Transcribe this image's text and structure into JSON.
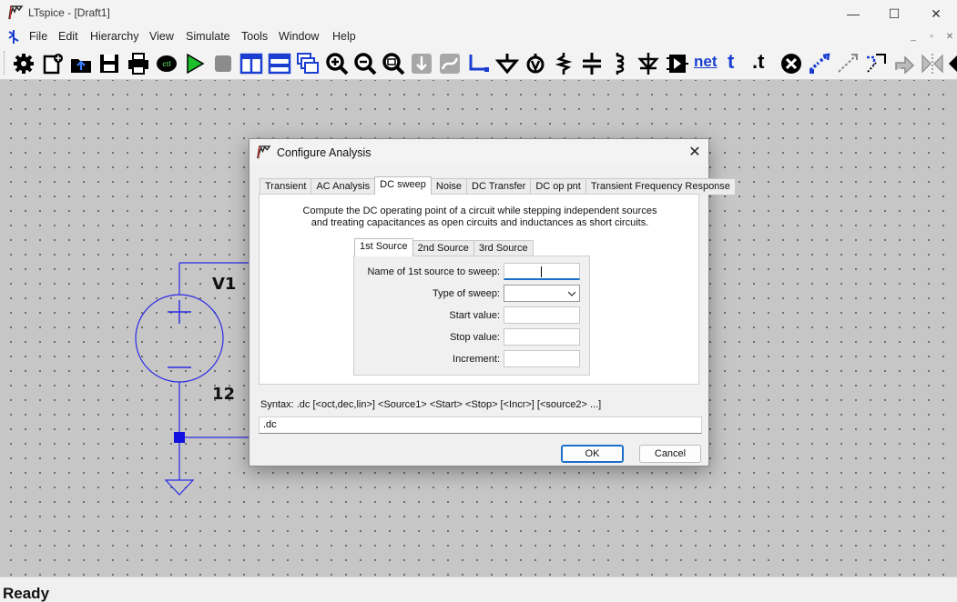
{
  "window": {
    "title": "LTspice - [Draft1]",
    "controls": {
      "minimize": "—",
      "maximize": "☐",
      "close": "✕"
    }
  },
  "menu": {
    "items": [
      "File",
      "Edit",
      "Hierarchy",
      "View",
      "Simulate",
      "Tools",
      "Window",
      "Help"
    ],
    "mdi_controls": [
      "_",
      "▫",
      "✕"
    ]
  },
  "toolbar": {
    "icons": [
      "gear-icon",
      "new-schematic-icon",
      "open-icon",
      "save-icon",
      "print-icon",
      "control-panel-icon",
      "run-icon",
      "halt-icon",
      "tile-vertical-icon",
      "tile-horizontal-icon",
      "cascade-icon",
      "zoom-in-icon",
      "zoom-out-icon",
      "zoom-fit-icon",
      "pan-icon",
      "autoscale-icon",
      "wire-icon",
      "ground-icon",
      "label-icon",
      "resistor-icon",
      "capacitor-icon",
      "inductor-icon",
      "diode-icon",
      "component-icon",
      "net-icon",
      "text-icon",
      "spice-directive-icon",
      "delete-icon",
      "move-icon",
      "drag-icon",
      "rotate-icon",
      "undo-icon",
      "mirror-icon",
      "redo-icon"
    ],
    "net_text": "net",
    "text_tool": "t",
    "directive_tool": ".t"
  },
  "schematic": {
    "source_name": "V1",
    "source_value": "12"
  },
  "status": {
    "text": "Ready"
  },
  "dialog": {
    "title": "Configure Analysis",
    "close": "✕",
    "tabs": [
      "Transient",
      "AC Analysis",
      "DC sweep",
      "Noise",
      "DC Transfer",
      "DC op pnt",
      "Transient Frequency Response"
    ],
    "active_tab": "DC sweep",
    "description_line1": "Compute the DC operating point of a circuit while stepping independent sources",
    "description_line2": "and treating capacitances as open circuits and inductances as short circuits.",
    "source_tabs": [
      "1st Source",
      "2nd Source",
      "3rd Source"
    ],
    "active_source_tab": "1st Source",
    "fields": {
      "name_label": "Name of 1st source to sweep:",
      "name_value": "",
      "type_label": "Type of sweep:",
      "type_value": "",
      "start_label": "Start value:",
      "start_value": "",
      "stop_label": "Stop value:",
      "stop_value": "",
      "increment_label": "Increment:",
      "increment_value": ""
    },
    "syntax": "Syntax:  .dc [<oct,dec,lin>] <Source1> <Start> <Stop> [<Incr>] [<source2> ...]",
    "command": ".dc",
    "ok_label": "OK",
    "cancel_label": "Cancel"
  }
}
